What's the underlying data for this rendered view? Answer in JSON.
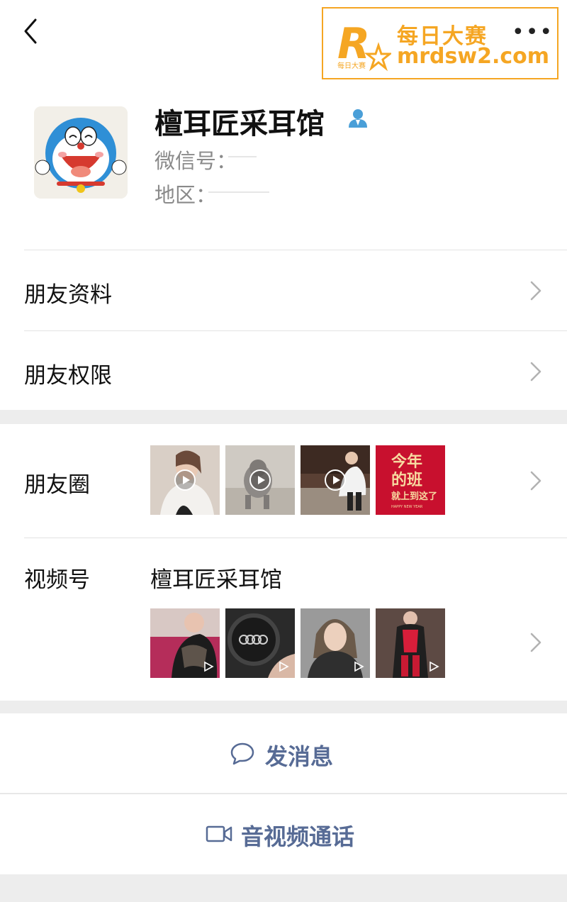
{
  "header": {
    "watermark": {
      "title": "每日大赛",
      "url": "mrdsw2.com",
      "logo_letter": "R",
      "logo_subtext": "每日大赛"
    },
    "more_label": "•••"
  },
  "profile": {
    "name": "檀耳匠采耳馆",
    "wechat_id_label": "微信号：",
    "region_label": "地区："
  },
  "rows": {
    "friend_profile": "朋友资料",
    "friend_permissions": "朋友权限",
    "moments": "朋友圈",
    "channels": "视频号",
    "channels_name": "檀耳匠采耳馆"
  },
  "moments_thumbs": [
    {
      "type": "video",
      "color": "#d9cfc6"
    },
    {
      "type": "video",
      "color": "#bdb9b2"
    },
    {
      "type": "video",
      "color": "#8b7b6a"
    },
    {
      "type": "image",
      "color": "#c8102e",
      "text_line1": "今年",
      "text_line2": "的班",
      "text_line3": "就上到这了",
      "text_line4": "HAPPY NEW YEAR"
    }
  ],
  "channel_thumbs": [
    {
      "color": "#b52d5a"
    },
    {
      "color": "#2a2a2a"
    },
    {
      "color": "#8d8d8d"
    },
    {
      "color": "#3a2a2a"
    }
  ],
  "actions": {
    "send_message": "发消息",
    "video_call": "音视频通话"
  },
  "colors": {
    "link_blue": "#576b95",
    "watermark_orange": "#f5a623",
    "contact_icon_blue": "#4a9fd8"
  }
}
